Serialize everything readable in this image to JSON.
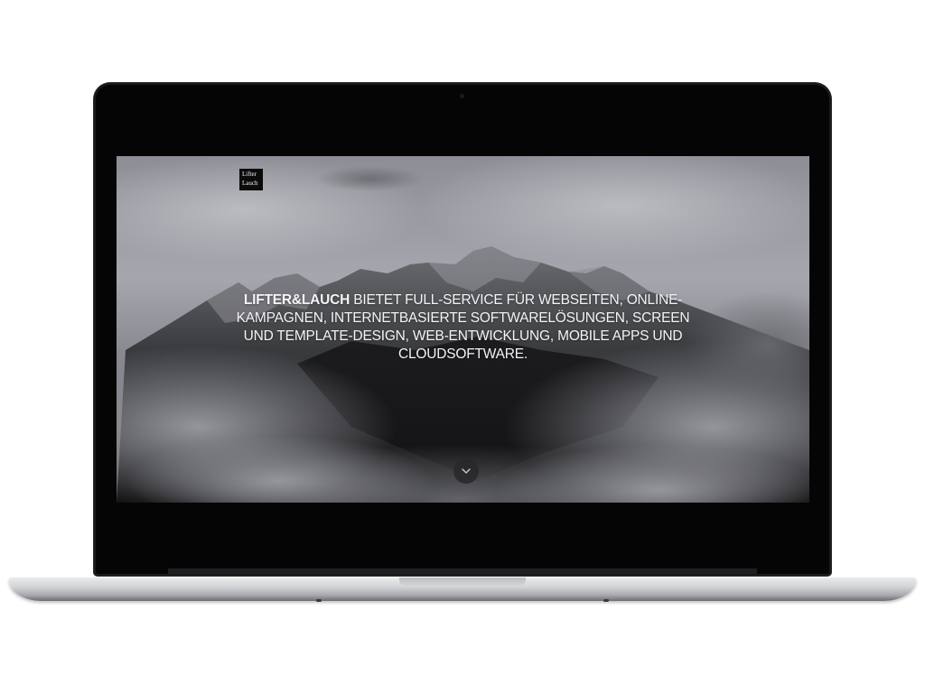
{
  "site": {
    "logo": {
      "line1": "Lifter",
      "line2": "Lauch"
    },
    "hero": {
      "brand": "LIFTER&LAUCH",
      "tagline": " BIETET FULL-SERVICE FÜR WEBSEITEN, ONLINE-KAMPAGNEN, INTERNETBASIERTE SOFTWARELÖSUNGEN, SCREEN UND TEMPLATE-DESIGN, WEB-ENTWICKLUNG, MOBILE APPS UND CLOUDSOFTWARE."
    },
    "scroll_button": {
      "icon": "chevron-down-icon"
    }
  },
  "colors": {
    "bezel": "#050505",
    "text": "#f4f4f6",
    "scroll_button_bg": "#28282c",
    "logo_bg": "#0b0b0b"
  }
}
